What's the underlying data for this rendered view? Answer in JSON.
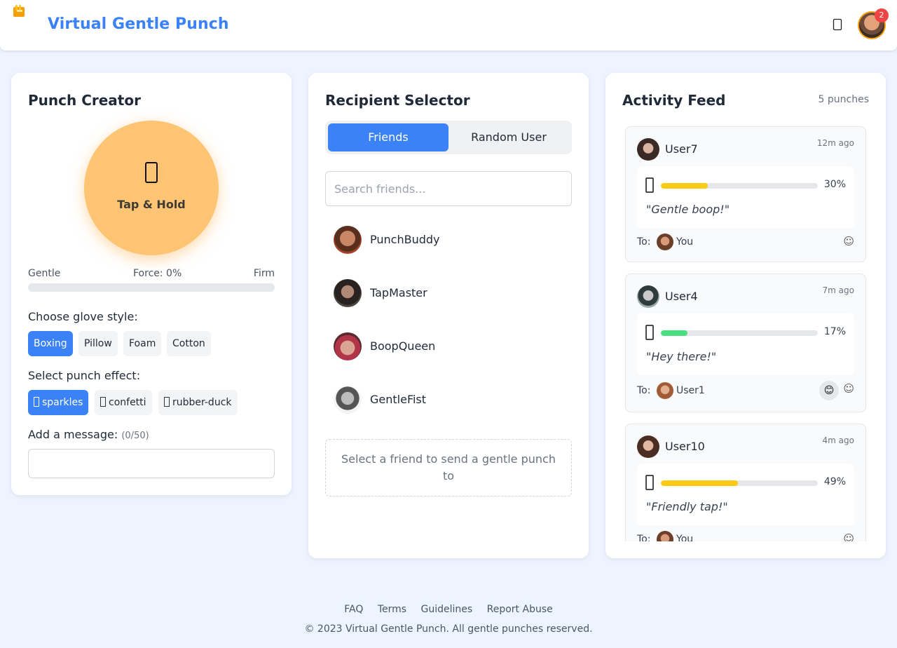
{
  "header": {
    "app_title": "Virtual Gentle Punch",
    "notification_count": "2",
    "logo_icon": "glove-logo-icon",
    "bell_icon": "bell-icon"
  },
  "creator": {
    "title": "Punch Creator",
    "punch_button": {
      "icon": "glove-icon",
      "glyph": "🥊",
      "label": "Tap & Hold"
    },
    "force": {
      "min_label": "Gentle",
      "value_label": "Force: 0%",
      "max_label": "Firm",
      "value": 0
    },
    "glove_section_label": "Choose glove style:",
    "gloves": [
      "Boxing",
      "Pillow",
      "Foam",
      "Cotton"
    ],
    "selected_glove": "Boxing",
    "effect_section_label": "Select punch effect:",
    "effects": [
      {
        "icon": "sparkles-icon",
        "glyph": "✨",
        "label": "sparkles"
      },
      {
        "icon": "confetti-icon",
        "glyph": "🎉",
        "label": "confetti"
      },
      {
        "icon": "rubber-duck-icon",
        "glyph": "🦆",
        "label": "rubber-duck"
      }
    ],
    "selected_effect": "sparkles",
    "message_label": "Add a message:",
    "message_count": "(0/50)",
    "message_value": ""
  },
  "recipient": {
    "title": "Recipient Selector",
    "tabs": [
      "Friends",
      "Random User"
    ],
    "active_tab": "Friends",
    "search_placeholder": "Search friends...",
    "friends": [
      "PunchBuddy",
      "TapMaster",
      "BoopQueen",
      "GentleFist"
    ],
    "hint": "Select a friend to send a gentle punch to"
  },
  "feed": {
    "title": "Activity Feed",
    "count": "5 punches",
    "items": [
      {
        "sender": "User7",
        "time": "12m ago",
        "force_label": "30%",
        "force": 0.3,
        "color": "#facc15",
        "message": "\"Gentle boop!\"",
        "to_label": "To:",
        "recipient": "You",
        "reactions": []
      },
      {
        "sender": "User4",
        "time": "7m ago",
        "force_label": "17%",
        "force": 0.17,
        "color": "#4ade80",
        "message": "\"Hey there!\"",
        "to_label": "To:",
        "recipient": "User1",
        "reactions": [
          "😊"
        ]
      },
      {
        "sender": "User10",
        "time": "4m ago",
        "force_label": "49%",
        "force": 0.49,
        "color": "#facc15",
        "message": "\"Friendly tap!\"",
        "to_label": "To:",
        "recipient": "You",
        "reactions": []
      }
    ]
  },
  "footer": {
    "links": [
      "FAQ",
      "Terms",
      "Guidelines",
      "Report Abuse"
    ],
    "copyright": "© 2023 Virtual Gentle Punch. All gentle punches reserved."
  },
  "colors": {
    "accent": "#3b82f6",
    "punch_button": "#fdc474",
    "badge": "#ef4444",
    "background": "#eef4fd"
  }
}
